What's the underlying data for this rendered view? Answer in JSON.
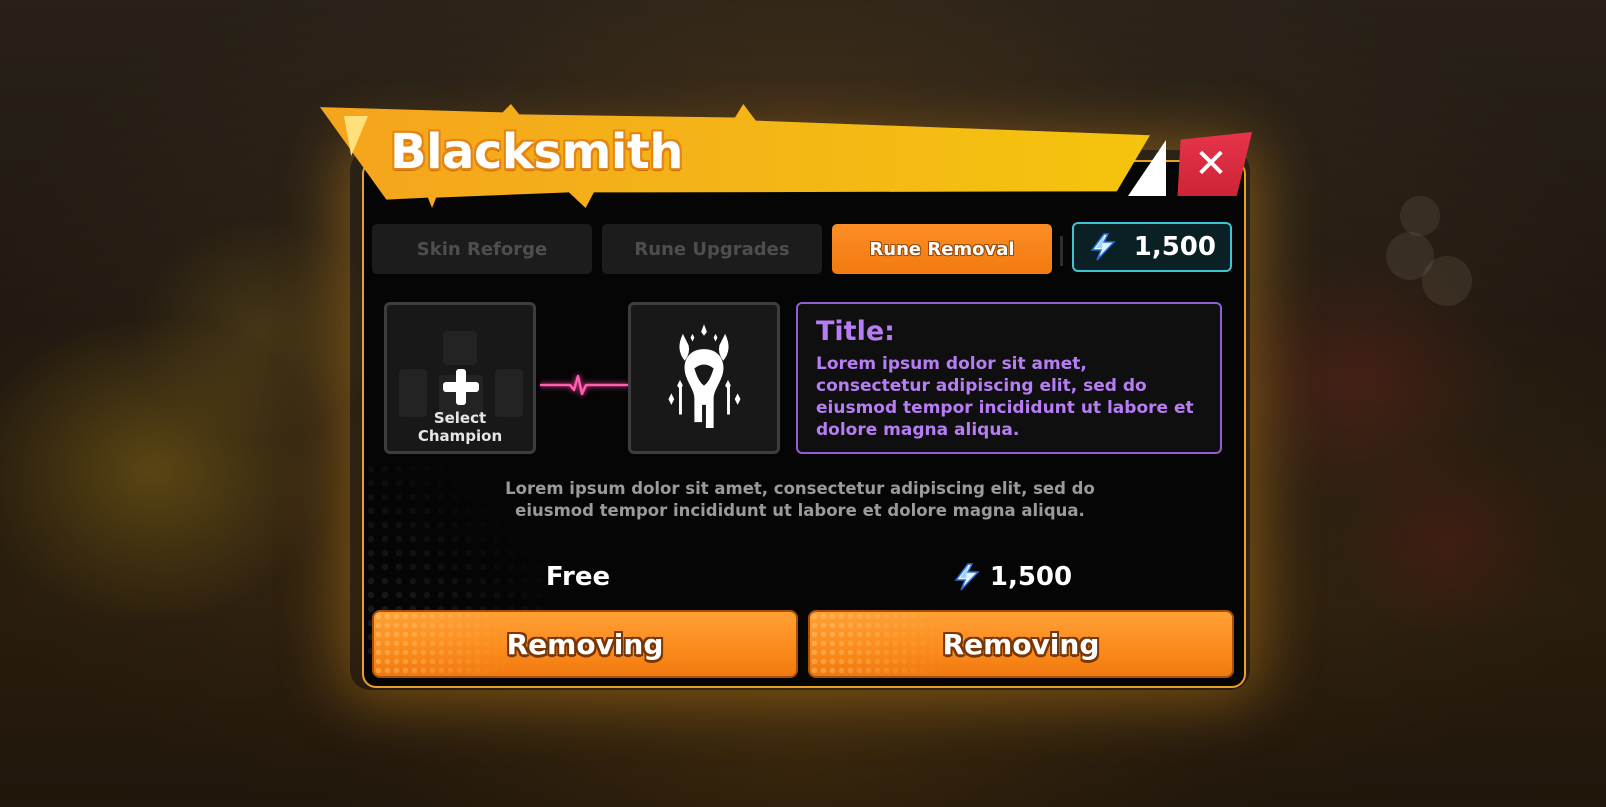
{
  "window": {
    "title": "Blacksmith"
  },
  "tabs": [
    {
      "label": "Skin Reforge",
      "active": false
    },
    {
      "label": "Rune Upgrades",
      "active": false
    },
    {
      "label": "Rune Removal",
      "active": true
    }
  ],
  "currency": {
    "icon": "gem-icon",
    "value": "1,500"
  },
  "slots": {
    "select_label_line1": "Select",
    "select_label_line2": "Champion",
    "rune_icon": "demon-rune-icon"
  },
  "info": {
    "title": "Title:",
    "text": "Lorem ipsum dolor sit amet, consectetur adipiscing elit, sed do eiusmod tempor incididunt ut labore et dolore magna aliqua."
  },
  "description": "Lorem ipsum dolor sit amet, consectetur adipiscing elit, sed do eiusmod tempor incididunt ut labore et dolore magna aliqua.",
  "options": [
    {
      "price": "Free",
      "button_label": "Removing"
    },
    {
      "price": "1,500",
      "price_icon": "gem-icon",
      "button_label": "Removing"
    }
  ],
  "colors": {
    "accent_orange": "#f7891b",
    "banner_yellow": "#f4b517",
    "info_purple": "#b77df5",
    "currency_cyan": "#3ec5d1",
    "close_red": "#dc2e40"
  }
}
